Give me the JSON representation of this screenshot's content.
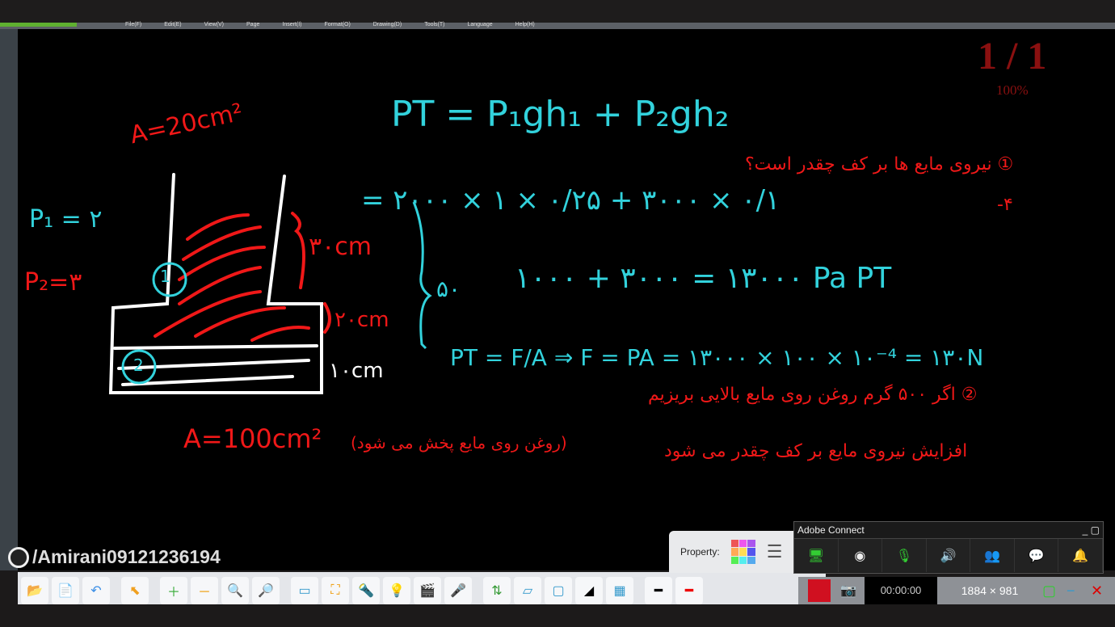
{
  "menu": [
    "File(F)",
    "Edit(E)",
    "View(V)",
    "Page",
    "Insert(I)",
    "Format(O)",
    "Drawing(D)",
    "Tools(T)",
    "Language",
    "Help(H)"
  ],
  "page_indicator": "1 / 1",
  "zoom": "100%",
  "board": {
    "cyan": {
      "eq1": "PT = P₁gh₁ + P₂gh₂",
      "eq2": "= ۲۰۰۰ × ۱ × ۰/۲۵ + ۳۰۰۰ × ۰/۱",
      "eq3": "۱۰۰۰ + ۳۰۰۰ = ۱۳۰۰۰ Pa PT",
      "eq3pre": "۵۰",
      "eq4": "PT = F/A ⇒ F = PA = ۱۳۰۰۰ × ۱۰۰ × ۱۰⁻⁴ = ۱۳۰N",
      "p1": "P₁ = ۲",
      "label1": "1",
      "label2": "2"
    },
    "red": {
      "a_top": "A=20cm²",
      "p2": "P₂=۳",
      "h1": "۳۰cm",
      "h2": "۲۰cm",
      "a_bottom": "A=100cm²",
      "q1": "① نیروی مایع ها بر کف چقدر است؟",
      "q2": "② اگر ۵۰۰ گرم روغن روی مایع بالایی بریزیم",
      "q2b": "افزایش نیروی مایع بر کف چقدر می شود",
      "note": "(روغن روی مایع پخش می شود)",
      "power": "-۴"
    },
    "white": {
      "h3": "۱۰cm"
    }
  },
  "watermark": "/Amirani09121236194",
  "property_label": "Property:",
  "adobe": {
    "title": "Adobe Connect",
    "icons": [
      "share-screen",
      "webcam",
      "microphone",
      "speaker",
      "attendees",
      "chat",
      "notifications"
    ]
  },
  "recorder": {
    "time": "00:00:00",
    "resolution": "1884 × 981"
  },
  "colors": {
    "cyan": "#32d2dc",
    "red": "#f01818"
  }
}
